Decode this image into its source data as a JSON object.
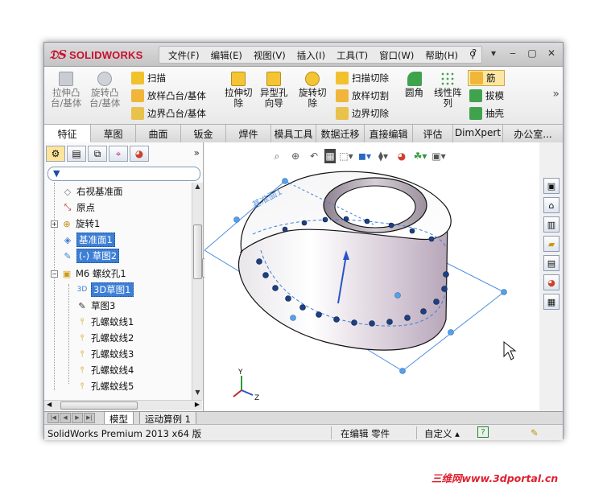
{
  "app": {
    "logo_text": "SOLIDWORKS",
    "menu": [
      "文件(F)",
      "编辑(E)",
      "视图(V)",
      "插入(I)",
      "工具(T)",
      "窗口(W)",
      "帮助(H)"
    ]
  },
  "ribbon": {
    "extrude_boss": "拉伸凸\n台/基体",
    "revolve_boss": "旋转凸\n台/基体",
    "sweep": "扫描",
    "loft_boss": "放样凸台/基体",
    "boundary_boss": "边界凸台/基体",
    "extrude_cut": "拉伸切\n除",
    "hole_wizard": "异型孔\n向导",
    "revolve_cut": "旋转切\n除",
    "sweep_cut": "扫描切除",
    "loft_cut": "放样切割",
    "boundary_cut": "边界切除",
    "fillet": "圆角",
    "linear_pattern": "线性阵\n列",
    "rib": "筋",
    "draft": "拔模",
    "shell": "抽壳"
  },
  "tabs": [
    "特征",
    "草图",
    "曲面",
    "钣金",
    "焊件",
    "模具工具",
    "数据迁移",
    "直接编辑",
    "评估",
    "DimXpert",
    "办公室..."
  ],
  "tree": {
    "items": [
      {
        "label": "右视基准面",
        "icon": "plane-icon"
      },
      {
        "label": "原点",
        "icon": "origin-icon"
      },
      {
        "label": "旋转1",
        "icon": "revolve-icon"
      },
      {
        "label": "基准面1",
        "icon": "plane-icon"
      },
      {
        "label": "(-) 草图2",
        "icon": "sketch-icon"
      },
      {
        "label": "M6 螺纹孔1",
        "icon": "hole-icon"
      },
      {
        "label": "3D草图1",
        "icon": "3d-sketch-icon"
      },
      {
        "label": "草图3",
        "icon": "sketch-icon"
      },
      {
        "label": "孔螺蚊线1",
        "icon": "thread-icon"
      },
      {
        "label": "孔螺蚊线2",
        "icon": "thread-icon"
      },
      {
        "label": "孔螺蚊线3",
        "icon": "thread-icon"
      },
      {
        "label": "孔螺蚊线4",
        "icon": "thread-icon"
      },
      {
        "label": "孔螺蚊线5",
        "icon": "thread-icon"
      }
    ]
  },
  "viewport": {
    "plane_label": "基准面1",
    "triad": {
      "y": "Y",
      "z": "Z"
    }
  },
  "bottom_tabs": [
    "模型",
    "运动算例 1"
  ],
  "status": {
    "product": "SolidWorks Premium 2013 x64 版",
    "mode": "在编辑 零件",
    "custom": "自定义 ▴",
    "help": "?"
  },
  "watermark": "三维网www.3dportal.cn",
  "colors": {
    "accent": "#3d7fd6",
    "brand": "#c8102e",
    "part_face": "#d8ccd8"
  }
}
